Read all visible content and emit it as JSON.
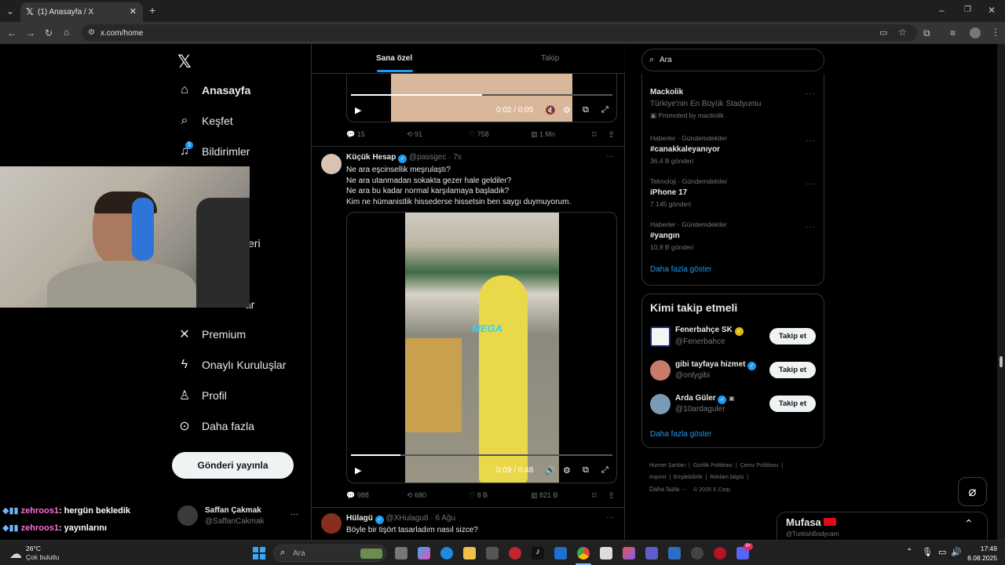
{
  "browser": {
    "tab_title": "(1) Anasayfa / X",
    "url": "x.com/home"
  },
  "nav": {
    "items": [
      {
        "label": "Anasayfa",
        "icon": "home-icon"
      },
      {
        "label": "Keşfet",
        "icon": "search-icon"
      },
      {
        "label": "Bildirimler",
        "icon": "bell-icon",
        "badge": "1"
      },
      {
        "label": "eri",
        "icon": "bookmark-icon"
      },
      {
        "label": "ar",
        "icon": "people-icon"
      },
      {
        "label": "Premium",
        "icon": "x-icon"
      },
      {
        "label": "Onaylı Kuruluşlar",
        "icon": "lightning-icon"
      },
      {
        "label": "Profil",
        "icon": "person-icon"
      },
      {
        "label": "Daha fazla",
        "icon": "more-circle-icon"
      }
    ],
    "post_button": "Gönderi yayınla",
    "account": {
      "name": "Saffan Çakmak",
      "handle": "@SaffanCakmak"
    }
  },
  "feed": {
    "tabs": [
      "Sana özel",
      "Takip"
    ],
    "tweet1": {
      "video_time": "0:02 / 0:05",
      "progress": 0.5,
      "stats": {
        "replies": "15",
        "reposts": "91",
        "likes": "758",
        "views": "1 Mn"
      }
    },
    "tweet2": {
      "name": "Küçük Hesap",
      "handle": "@passgec",
      "time": "7s",
      "lines": [
        "Ne ara eşcinsellik meşrulaştı?",
        "Ne ara utanmadan sokakta gezer hale geldiler?",
        "Ne ara bu kadar normal karşılamaya başladık?",
        "Kim ne hümanistlik hissederse hissetsin ben saygı duymuyorum."
      ],
      "video_time": "0:09 / 0:48",
      "progress": 0.19,
      "watermark": "MEGA",
      "stats": {
        "replies": "988",
        "reposts": "680",
        "likes": "8 B",
        "views": "821 B"
      }
    },
    "tweet3": {
      "name": "Hülagü",
      "handle": "@XHulagu8",
      "time": "6 Ağu",
      "text": "Böyle bir tişört tasarladım nasıl sizce?"
    }
  },
  "right": {
    "search_placeholder": "Ara",
    "promoted": {
      "title": "Mackolik",
      "subtitle": "Türkiye'nin En Büyük Stadyumu",
      "note": "Promoted by mackolik"
    },
    "trends": [
      {
        "category": "Haberler · Gündemdekiler",
        "title": "#canakkaleyanıyor",
        "count": "36,4 B gönderi"
      },
      {
        "category": "Teknoloji · Gündemdekiler",
        "title": "iPhone 17",
        "count": "7.145 gönderi"
      },
      {
        "category": "Haberler · Gündemdekiler",
        "title": "#yangın",
        "count": "10,9 B gönderi"
      }
    ],
    "show_more": "Daha fazla göster",
    "who_to_follow_title": "Kimi takip etmeli",
    "follow": [
      {
        "name": "Fenerbahçe SK",
        "handle": "@Fenerbahce",
        "button": "Takip et"
      },
      {
        "name": "gibi tayfaya hizmet",
        "handle": "@onlygibi",
        "button": "Takip et"
      },
      {
        "name": "Arda Güler",
        "handle": "@10ardaguler",
        "button": "Takip et"
      }
    ],
    "footer": [
      "Hizmet Şartları",
      "Gizlilik Politikası",
      "Çerez Politikası",
      "Imprint",
      "Erişilebilirlik",
      "Reklam bilgisi",
      "Daha fazla ···",
      "© 2025 X Corp."
    ]
  },
  "dm": {
    "name": "Mufasa",
    "handle": "@TurkishBodycam"
  },
  "chat": [
    {
      "user": "zehroos1",
      "msg": ": hergün bekledik"
    },
    {
      "user": "zehroos1",
      "msg": ": yayınlarını"
    }
  ],
  "taskbar": {
    "weather_temp": "26°C",
    "weather_desc": "Çok bulutlu",
    "search_placeholder": "Ara",
    "time": "17:49",
    "date": "8.08.2025",
    "discord_badge": "9+"
  }
}
